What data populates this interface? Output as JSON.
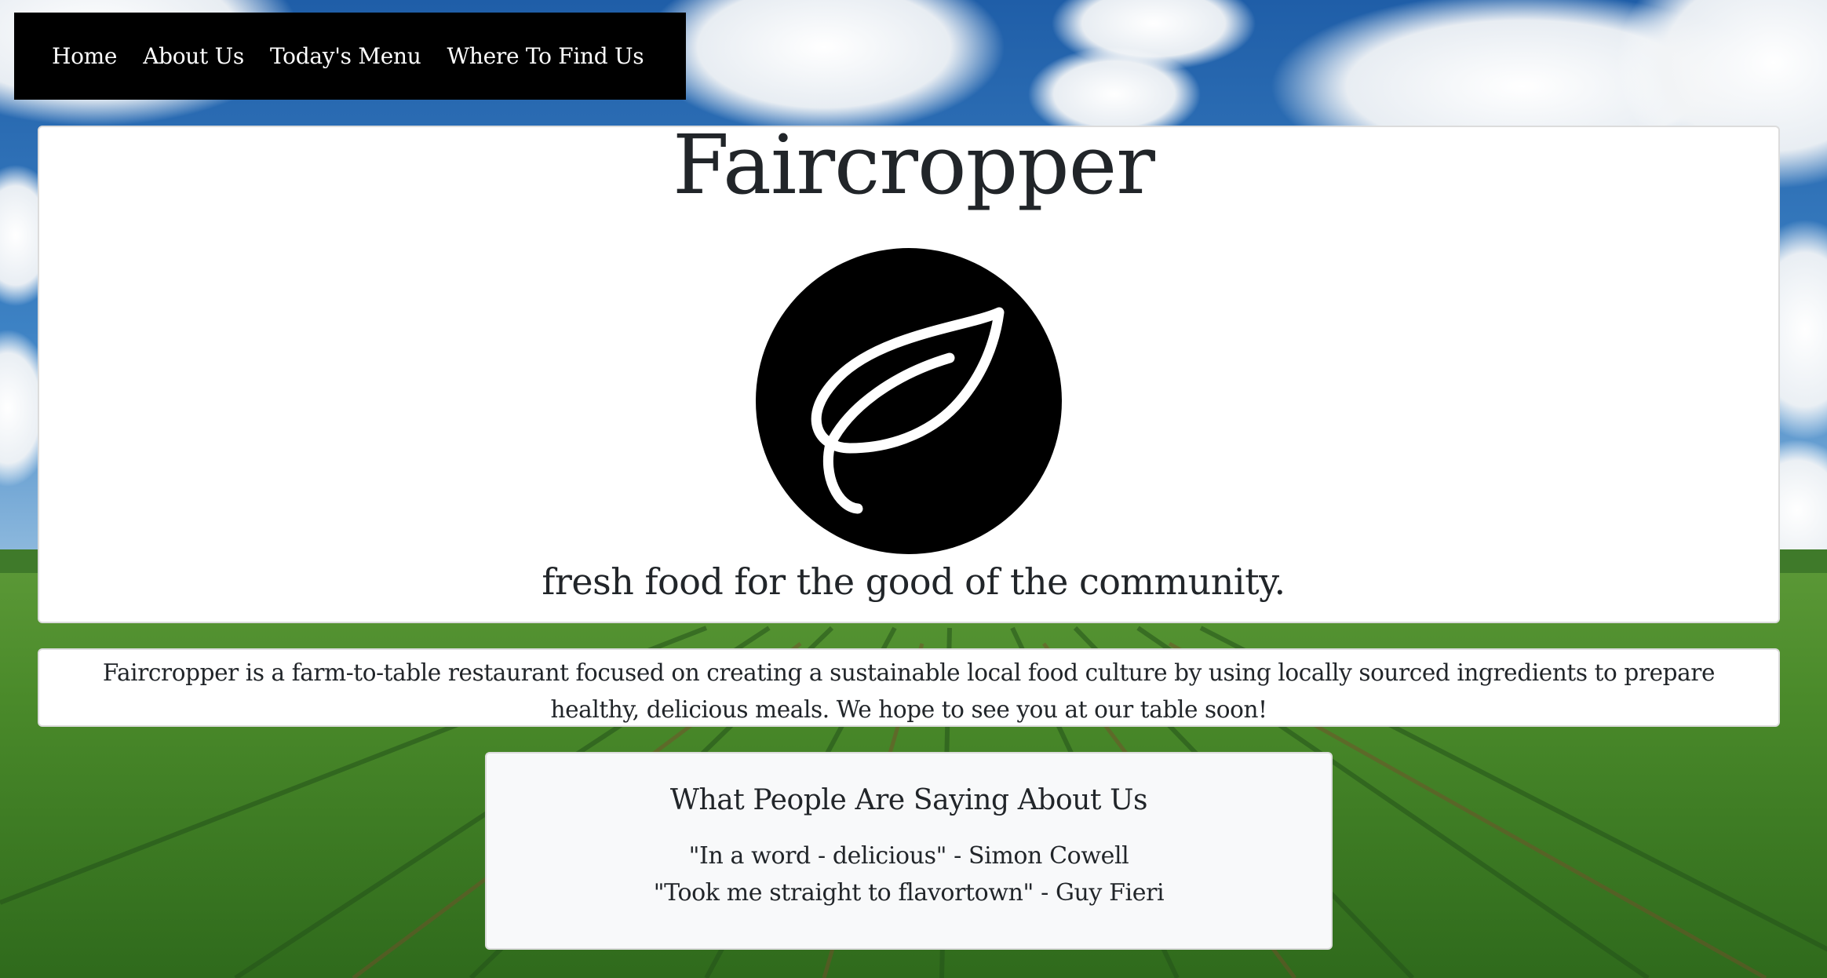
{
  "nav": {
    "items": [
      {
        "label": "Home"
      },
      {
        "label": "About Us"
      },
      {
        "label": "Today's Menu"
      },
      {
        "label": "Where To Find Us"
      }
    ]
  },
  "hero": {
    "title": "Faircropper",
    "logo_icon": "leaf-icon",
    "tagline": "fresh food for the good of the community."
  },
  "about": {
    "text": "Faircropper is a farm-to-table restaurant focused on creating a sustainable local food culture by using locally sourced ingredients to prepare healthy, delicious meals. We hope to see you at our table soon!"
  },
  "testimonials": {
    "heading": "What People Are Saying About Us",
    "quotes": [
      "\"In a word - delicious\" - Simon Cowell",
      "\"Took me straight to flavortown\" - Guy Fieri"
    ]
  },
  "colors": {
    "nav_background": "#000000",
    "nav_text": "#ffffff",
    "card_background": "#ffffff",
    "testimonial_background": "#f8f9fa",
    "text": "#212529"
  }
}
